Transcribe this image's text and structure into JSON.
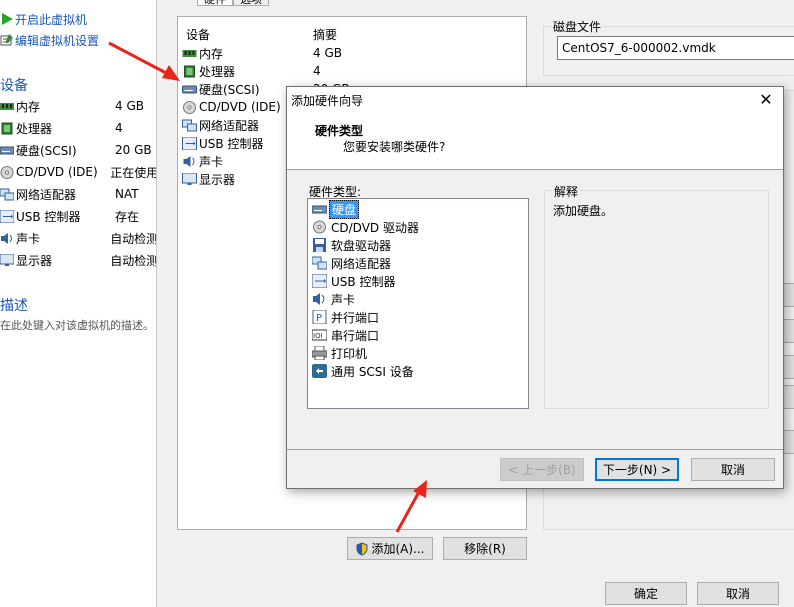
{
  "left_panel": {
    "actions": [
      {
        "label": "开启此虚拟机",
        "icon": "play-icon"
      },
      {
        "label": "编辑虚拟机设置",
        "icon": "edit-settings-icon"
      }
    ],
    "devices_title": "设备",
    "devices": [
      {
        "name": "内存",
        "value": "4 GB",
        "icon": "memory-icon"
      },
      {
        "name": "处理器",
        "value": "4",
        "icon": "cpu-icon"
      },
      {
        "name": "硬盘(SCSI)",
        "value": "20 GB",
        "icon": "harddisk-icon"
      },
      {
        "name": "CD/DVD (IDE)",
        "value": "正在使用",
        "icon": "cd-dvd-icon"
      },
      {
        "name": "网络适配器",
        "value": "NAT",
        "icon": "network-adapter-icon"
      },
      {
        "name": "USB 控制器",
        "value": "存在",
        "icon": "usb-icon"
      },
      {
        "name": "声卡",
        "value": "自动检测",
        "icon": "sound-card-icon"
      },
      {
        "name": "显示器",
        "value": "自动检测",
        "icon": "display-icon"
      }
    ],
    "description_title": "描述",
    "description_placeholder": "在此处键入对该虚拟机的描述。"
  },
  "settings": {
    "tabs": [
      "硬件",
      "选项"
    ],
    "list_headers": {
      "device": "设备",
      "summary": "摘要"
    },
    "devices": [
      {
        "name": "内存",
        "value": "4 GB",
        "icon": "memory-icon"
      },
      {
        "name": "处理器",
        "value": "4",
        "icon": "cpu-icon"
      },
      {
        "name": "硬盘(SCSI)",
        "value": "20 GB",
        "icon": "harddisk-icon"
      },
      {
        "name": "CD/DVD (IDE)",
        "value": "",
        "icon": "cd-dvd-icon"
      },
      {
        "name": "网络适配器",
        "value": "",
        "icon": "network-adapter-icon"
      },
      {
        "name": "USB 控制器",
        "value": "",
        "icon": "usb-icon"
      },
      {
        "name": "声卡",
        "value": "",
        "icon": "sound-card-icon"
      },
      {
        "name": "显示器",
        "value": "",
        "icon": "display-icon"
      }
    ],
    "disk_file_label": "磁盘文件",
    "disk_file_value": "CentOS7_6-000002.vmdk",
    "add_button": "添加(A)...",
    "remove_button": "移除(R)",
    "ok_button": "确定",
    "cancel_button": "取消"
  },
  "wizard": {
    "title": "添加硬件向导",
    "header_title": "硬件类型",
    "header_subtitle": "您要安装哪类硬件?",
    "list_label": "硬件类型:",
    "hardware_types": [
      {
        "label": "硬盘",
        "icon": "harddisk-icon",
        "selected": true
      },
      {
        "label": "CD/DVD 驱动器",
        "icon": "cd-dvd-icon",
        "selected": false
      },
      {
        "label": "软盘驱动器",
        "icon": "floppy-icon",
        "selected": false
      },
      {
        "label": "网络适配器",
        "icon": "network-adapter-icon",
        "selected": false
      },
      {
        "label": "USB 控制器",
        "icon": "usb-icon",
        "selected": false
      },
      {
        "label": "声卡",
        "icon": "sound-card-icon",
        "selected": false
      },
      {
        "label": "并行端口",
        "icon": "parallel-port-icon",
        "selected": false
      },
      {
        "label": "串行端口",
        "icon": "serial-port-icon",
        "selected": false
      },
      {
        "label": "打印机",
        "icon": "printer-icon",
        "selected": false
      },
      {
        "label": "通用 SCSI 设备",
        "icon": "generic-scsi-icon",
        "selected": false
      }
    ],
    "explain_title": "解释",
    "explain_text": "添加硬盘。",
    "back_button": "< 上一步(B)",
    "next_button": "下一步(N) >",
    "cancel_button": "取消"
  },
  "colors": {
    "link": "#1a56b8",
    "selection": "#3399ff",
    "annotation_arrow": "#e8231c"
  }
}
